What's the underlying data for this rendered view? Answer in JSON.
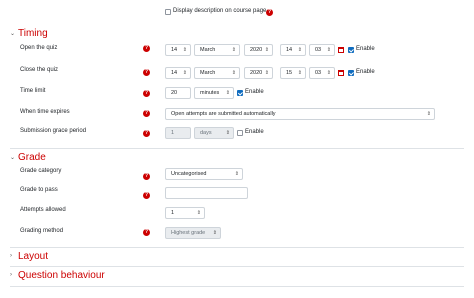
{
  "display_description": {
    "label": "Display description on course page",
    "checked": false
  },
  "sections": {
    "timing": "Timing",
    "grade": "Grade",
    "layout": "Layout",
    "question_behaviour": "Question behaviour"
  },
  "timing": {
    "open": {
      "label": "Open the quiz",
      "day": "14",
      "month": "March",
      "year": "2020",
      "hour": "14",
      "minute": "03",
      "enable_label": "Enable",
      "enabled": true
    },
    "close": {
      "label": "Close the quiz",
      "day": "14",
      "month": "March",
      "year": "2020",
      "hour": "15",
      "minute": "03",
      "enable_label": "Enable",
      "enabled": true
    },
    "time_limit": {
      "label": "Time limit",
      "value": "20",
      "unit": "minutes",
      "enable_label": "Enable",
      "enabled": true
    },
    "when_expires": {
      "label": "When time expires",
      "value": "Open attempts are submitted automatically"
    },
    "grace_period": {
      "label": "Submission grace period",
      "value": "1",
      "unit": "days",
      "enable_label": "Enable",
      "enabled": false
    }
  },
  "grade": {
    "category": {
      "label": "Grade category",
      "value": "Uncategorised"
    },
    "to_pass": {
      "label": "Grade to pass",
      "value": ""
    },
    "attempts": {
      "label": "Attempts allowed",
      "value": "1"
    },
    "method": {
      "label": "Grading method",
      "value": "Highest grade"
    }
  },
  "icons": {
    "help": "?",
    "chevron_down": "⌄",
    "chevron_right": "›",
    "select_arrow": "⇕"
  },
  "colors": {
    "accent": "#cc0000",
    "checkbox": "#0f6cbf"
  }
}
